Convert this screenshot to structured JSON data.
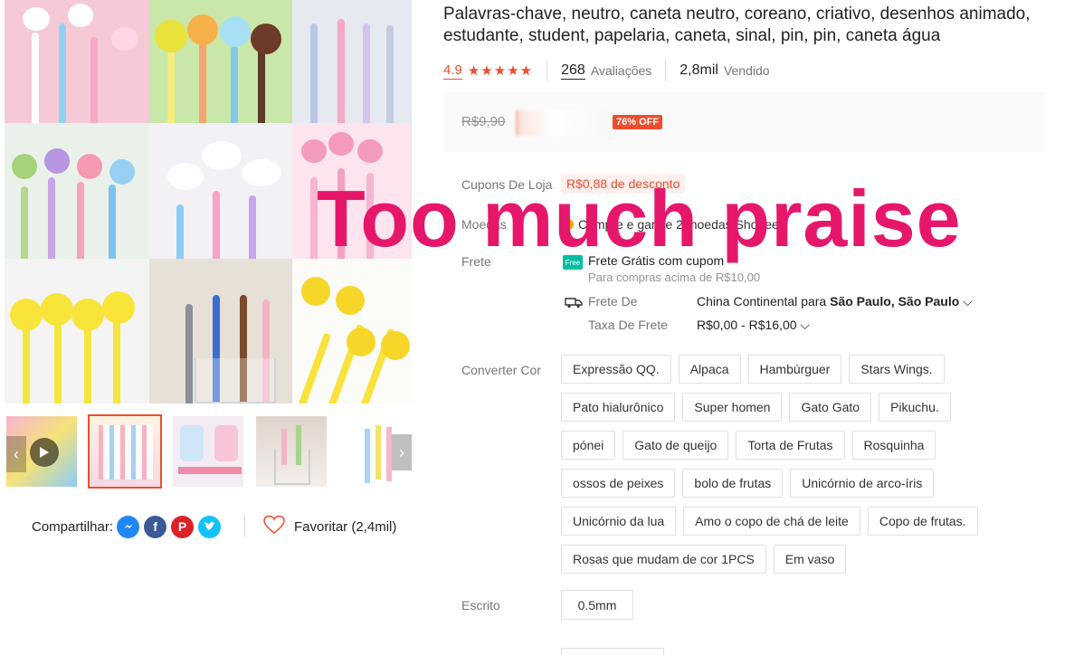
{
  "product": {
    "title": "Palavras-chave, neutro, caneta neutro, coreano, criativo, desenhos animado, estudante, student, papelaria, caneta, sinal, pin, pin, caneta água",
    "rating": "4.9",
    "stars": "★★★★★",
    "reviews_count": "268",
    "reviews_label": "Avaliações",
    "sold_count": "2,8mil",
    "sold_label": "Vendido",
    "old_price": "R$9,90",
    "discount_badge": "76% OFF"
  },
  "details": {
    "coupons_label": "Cupons De Loja",
    "coupon_value": "R$0,88 de desconto",
    "coins_label": "Moedas",
    "coins_text": "Compre e ganhe 2 moedas Shopee",
    "shipping_label": "Frete",
    "free_icon": "Free",
    "free_shipping_text": "Frete Grátis com cupom",
    "free_shipping_sub": "Para compras acima de R$10,00",
    "ship_from_label": "Frete De",
    "ship_from_origin": "China Continental",
    "ship_from_para": "para",
    "ship_from_dest": "São Paulo, São Paulo",
    "ship_fee_label": "Taxa De Frete",
    "ship_fee_value": "R$0,00 - R$16,00",
    "chevron": "⌵"
  },
  "variations": {
    "label": "Converter Cor",
    "options": [
      "Expressão QQ.",
      "Alpaca",
      "Hambúrguer",
      "Stars Wings.",
      "Pato hialurônico",
      "Super homen",
      "Gato Gato",
      "Pikuchu.",
      "pónei",
      "Gato de queijo",
      "Torta de Frutas",
      "Rosquinha",
      "ossos de peixes",
      "bolo de frutas",
      "Unicórnio de arco-íris",
      "Unicórnio da lua",
      "Amo o copo de chá de leite",
      "Copo de frutas.",
      "Rosas que mudam de cor 1PCS",
      "Em vaso"
    ]
  },
  "size": {
    "label": "Escrito",
    "value": "0.5mm"
  },
  "share": {
    "label": "Compartilhar:",
    "favorite_label": "Favoritar (2,4mil)"
  },
  "overlay": {
    "watermark": "Too much praise"
  },
  "colors": {
    "accent": "#ee4d2d",
    "watermark": "#e6176b"
  }
}
